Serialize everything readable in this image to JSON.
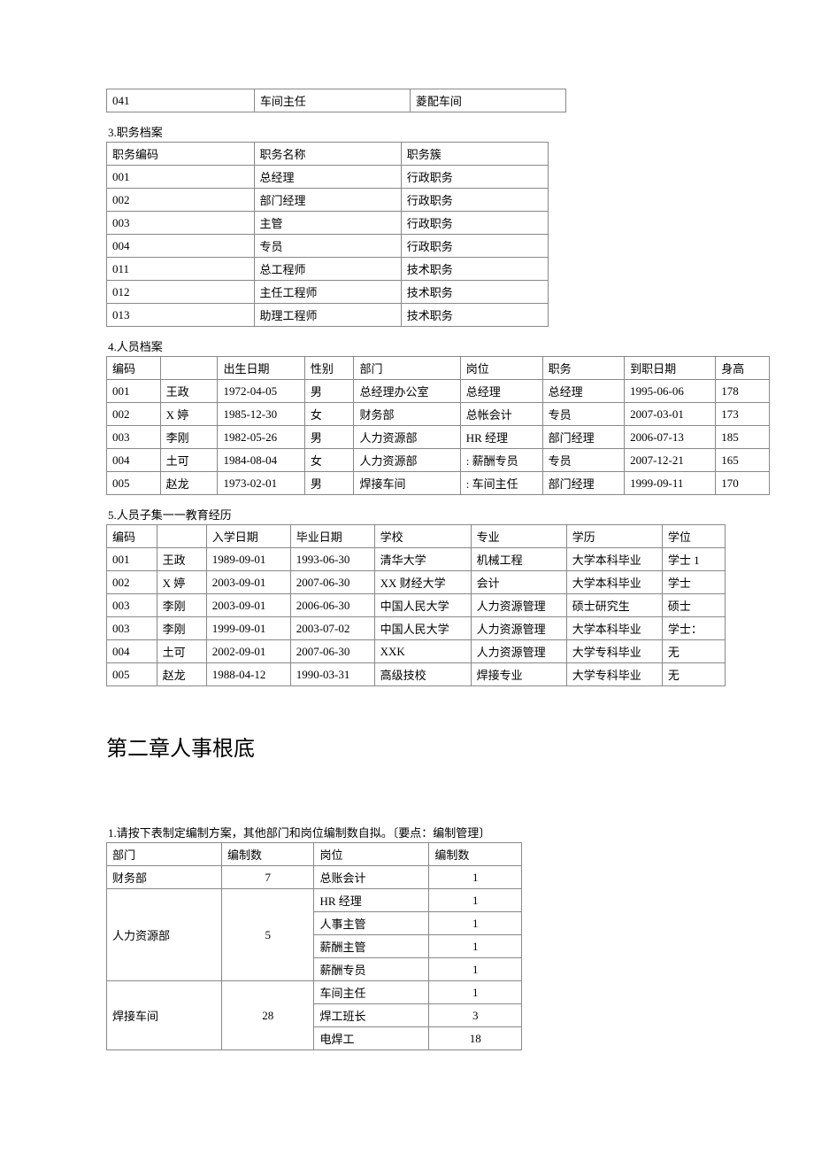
{
  "top_row": {
    "c1": "041",
    "c2": "车间主任",
    "c3": "菱配车间"
  },
  "sec3_title": "3.职务档案",
  "sec3_header": {
    "c1": "职务编码",
    "c2": "职务名称",
    "c3": "职务簇"
  },
  "sec3_rows": [
    {
      "c1": "001",
      "c2": "总经理",
      "c3": "行政职务"
    },
    {
      "c1": "002",
      "c2": "部门经理",
      "c3": "行政职务"
    },
    {
      "c1": "003",
      "c2": "主管",
      "c3": "行政职务"
    },
    {
      "c1": "004",
      "c2": "专员",
      "c3": "行政职务"
    },
    {
      "c1": "011",
      "c2": "总工程师",
      "c3": "技术职务"
    },
    {
      "c1": "012",
      "c2": "主任工程师",
      "c3": "技术职务"
    },
    {
      "c1": "013",
      "c2": "助理工程师",
      "c3": "技术职务"
    }
  ],
  "sec4_title": "4.人员档案",
  "sec4_header": {
    "c1": "编码",
    "c2": "",
    "c3": "出生日期",
    "c4": "性别",
    "c5": "部门",
    "c6": "岗位",
    "c7": "职务",
    "c8": "到职日期",
    "c9": "身高"
  },
  "sec4_rows": [
    {
      "c1": "001",
      "c2": "王政",
      "c3": "1972-04-05",
      "c4": "男",
      "c5": "总经理办公室",
      "c6": "总经理",
      "c7": "总经理",
      "c8": "1995-06-06",
      "c9": "178"
    },
    {
      "c1": "002",
      "c2": "X 婷",
      "c3": "1985-12-30",
      "c4": "女",
      "c5": "财务部",
      "c6": "总帐会计",
      "c7": "专员",
      "c8": "2007-03-01",
      "c9": "173"
    },
    {
      "c1": "003",
      "c2": "李刚",
      "c3": "1982-05-26",
      "c4": "男",
      "c5": "人力资源部",
      "c6": "HR 经理",
      "c7": "部门经理",
      "c8": "2006-07-13",
      "c9": "185"
    },
    {
      "c1": "004",
      "c2": "土可",
      "c3": "1984-08-04",
      "c4": "女",
      "c5": "人力资源部",
      "c6": ": 薪酬专员",
      "c7": "专员",
      "c8": "2007-12-21",
      "c9": "165"
    },
    {
      "c1": "005",
      "c2": "赵龙",
      "c3": "1973-02-01",
      "c4": "男",
      "c5": "焊接车间",
      "c6": ": 车间主任",
      "c7": "部门经理",
      "c8": "1999-09-11",
      "c9": "170"
    }
  ],
  "sec5_title": "5.人员子集一一教育经历",
  "sec5_header": {
    "c1": "编码",
    "c2": "",
    "c3": "入学日期",
    "c4": "毕业日期",
    "c5": "学校",
    "c6": "专业",
    "c7": "学历",
    "c8": "学位"
  },
  "sec5_rows": [
    {
      "c1": "001",
      "c2": "王政",
      "c3": "1989-09-01",
      "c4": "1993-06-30",
      "c5": "清华大学",
      "c6": "机械工程",
      "c7": "大学本科毕业",
      "c8": "学士 1"
    },
    {
      "c1": "002",
      "c2": "X 婷",
      "c3": "2003-09-01",
      "c4": "2007-06-30",
      "c5": "XX 财经大学",
      "c6": "会计",
      "c7": "大学本科毕业",
      "c8": "学士"
    },
    {
      "c1": "003",
      "c2": "李刚",
      "c3": "2003-09-01",
      "c4": "2006-06-30",
      "c5": "中国人民大学",
      "c6": "人力资源管理",
      "c7": "硕士研究生",
      "c8": "硕士"
    },
    {
      "c1": "003",
      "c2": "李刚",
      "c3": "1999-09-01",
      "c4": "2003-07-02",
      "c5": "中国人民大学",
      "c6": "人力资源管理",
      "c7": "大学本科毕业",
      "c8": "学士："
    },
    {
      "c1": "004",
      "c2": "土可",
      "c3": "2002-09-01",
      "c4": "2007-06-30",
      "c5": "XXK",
      "c6": "人力资源管理",
      "c7": "大学专科毕业",
      "c8": "无"
    },
    {
      "c1": "005",
      "c2": "赵龙",
      "c3": "1988-04-12",
      "c4": "1990-03-31",
      "c5": "高级技校",
      "c6": "焊接专业",
      "c7": "大学专科毕业",
      "c8": "无"
    }
  ],
  "chapter2_title": "第二章人事根底",
  "sec6_title": "1.请按下表制定编制方案，其他部门和岗位编制数自拟。〔要点：编制管理〕",
  "sec6_header": {
    "c1": "部门",
    "c2": "编制数",
    "c3": "岗位",
    "c4": "编制数"
  },
  "sec6": {
    "r1": {
      "dept": "财务部",
      "dept_count": "7",
      "pos": "总账会计",
      "pos_count": "1"
    },
    "r2": {
      "dept": "人力资源部",
      "dept_count": "5",
      "pos": "HR 经理",
      "pos_count": "1"
    },
    "r3": {
      "pos": "人事主管",
      "pos_count": "1"
    },
    "r4": {
      "pos": "薪酬主管",
      "pos_count": "1"
    },
    "r5": {
      "pos": "薪酬专员",
      "pos_count": "1"
    },
    "r6": {
      "dept": "焊接车间",
      "dept_count": "28",
      "pos": "车间主任",
      "pos_count": "1"
    },
    "r7": {
      "pos": "焊工班长",
      "pos_count": "3"
    },
    "r8": {
      "pos": "电焊工",
      "pos_count": "18"
    }
  }
}
